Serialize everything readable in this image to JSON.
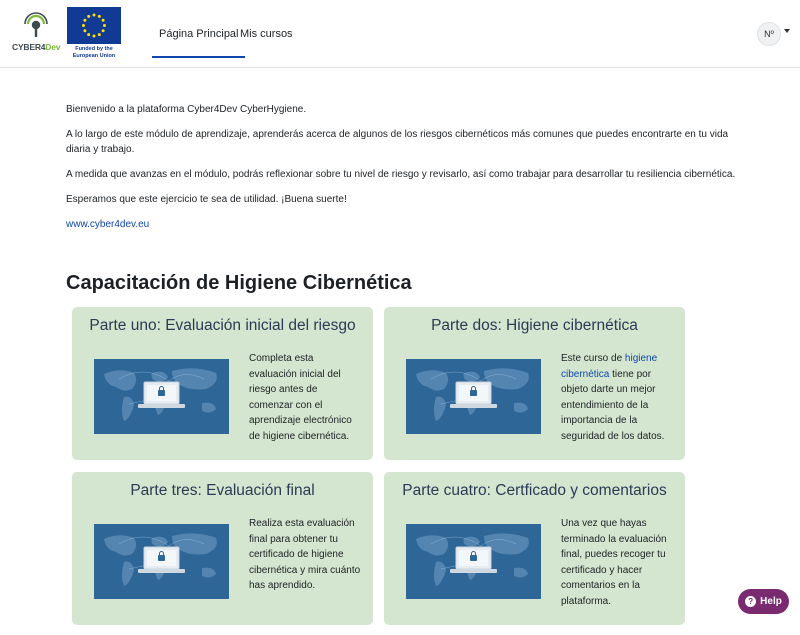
{
  "header": {
    "logo_text_main": "CYBER4",
    "logo_text_accent": "Dev",
    "eu_caption_line1": "Funded by the",
    "eu_caption_line2": "European Union",
    "nav": [
      {
        "label": "Página Principal"
      },
      {
        "label": "Mis cursos"
      }
    ],
    "avatar_initials": "Nº",
    "icons": [
      "cyber4dev-logo-icon",
      "eu-flag-icon",
      "caret-down-icon"
    ]
  },
  "intro": {
    "p1": "Bienvenido a la plataforma Cyber4Dev CyberHygiene.",
    "p2": "A lo largo de este módulo de aprendizaje, aprenderás acerca de algunos de los riesgos cibernéticos más comunes que puedes encontrarte en tu vida diaria y trabajo.",
    "p3": "A medida que avanzas en el módulo, podrás reflexionar sobre tu nivel de riesgo y revisarlo, así como trabajar para desarrollar tu resiliencia cibernética.",
    "p4": "Esperamos que este ejercicio te sea de utilidad. ¡Buena suerte!",
    "link": "www.cyber4dev.eu"
  },
  "section_title": "Capacitación de Higiene Cibernética",
  "cards": [
    {
      "title": "Parte uno: Evaluación inicial del riesgo",
      "desc": "Completa esta evaluación inicial del riesgo antes de comenzar con el aprendizaje electrónico de higiene cibernética."
    },
    {
      "title": "Parte dos: Higiene cibernética",
      "desc_pre": "Este curso de ",
      "desc_hl": "higiene cibernética",
      "desc_post": " tiene por objeto darte un mejor entendimiento de la importancia de la seguridad de los datos."
    },
    {
      "title": "Parte tres: Evaluación final",
      "desc": "Realiza esta evaluación final para obtener tu certificado de higiene cibernética y mira cuánto has aprendido."
    },
    {
      "title": "Parte cuatro: Certficado y comentarios",
      "desc": "Una vez que hayas terminado la evaluación final, puedes recoger tu certificado y hacer comentarios en la plataforma."
    }
  ],
  "help": {
    "label": "Help",
    "icon": "question-circle-icon"
  },
  "colors": {
    "card_bg": "#d4e6cf",
    "accent": "#0f47ad",
    "help_bg": "#7a2a6e",
    "image_bg": "#2e6697"
  }
}
